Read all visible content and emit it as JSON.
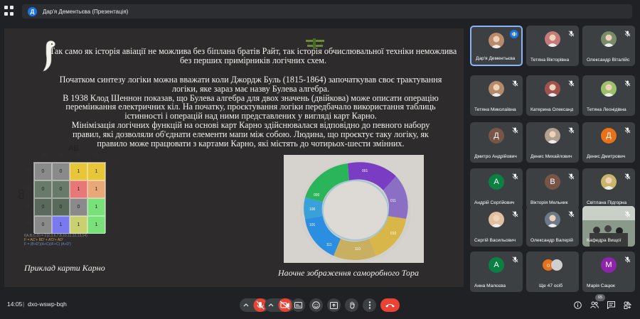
{
  "header": {
    "presenter_initial": "Д",
    "presentation_title": "Дар'я Дементьєва (Презентація)"
  },
  "slide": {
    "paragraph1": "Так само як історія авіації не можлива без біплана братів Райт, так  історія обчислювальної техніки неможлива без перших примірників логічних схем.",
    "paragraph2": "Початком синтезу логіки можна вважати коли Джордж Буль (1815-1864) започаткував своє трактування логіки, яке зараз має назву Булева алгебра.",
    "paragraph3": "В 1938 Клод Шеннон показав, що Булева алгебра для двох значень (двійкова) може описати операцію переміикання електричних кіл. На початку, проєктування логіки передбачало використання таблиць істинності і операцій над ними представлених у вигляді карт Карно.",
    "paragraph4": "Мінімізація логічних функцій на основі карт Карно здійснювалася відповідно до певного набору правил, які дозволяли об'єднати елементи мапи між собою. Людина, що проєктує таку логіку, як правило може працювати з картами Карно, які містять  до чотирьох-шести змінних.",
    "kmap": {
      "ab_label": "AB",
      "cd_label": "CD",
      "col_heads": [
        "00",
        "01",
        "11",
        "10"
      ],
      "row_heads": [
        "00",
        "01",
        "11",
        "10"
      ],
      "cells": [
        "0",
        "0",
        "1",
        "1",
        "0",
        "0",
        "1",
        "1",
        "0",
        "0",
        "0",
        "1",
        "0",
        "1",
        "1",
        "1"
      ],
      "formula1": "f(A,B,C,D) = Σ(2,3,6,7,8,10,11,12,13,14)",
      "formula2": "F = AC'+ BD' + A'D'+ AD'",
      "formula3": "F = (B+D')(A+C)(A'+C)  (A+D')"
    },
    "caption_left": "Приклад карти Карно",
    "caption_right": "Наочне зображення саморобного Тора",
    "torus_labels": [
      "000",
      "001",
      "011",
      "010",
      "110",
      "111",
      "101",
      "100"
    ]
  },
  "participants": [
    {
      "name": "Дар'я Дементьєва",
      "type": "photo",
      "color": "#b98a6b",
      "speaking": true
    },
    {
      "name": "Тетяна Вікторівна",
      "type": "photo",
      "color": "#c47a7a"
    },
    {
      "name": "Олександр Віталійович",
      "type": "photo",
      "color": "#7a8b6a"
    },
    {
      "name": "Тетяна Миколаївна",
      "type": "photo",
      "color": "#b58a6a"
    },
    {
      "name": "Катерина Олександрівна",
      "type": "photo",
      "color": "#a0524f"
    },
    {
      "name": "Тетяна Леонідівна",
      "type": "photo",
      "color": "#9bbf6a"
    },
    {
      "name": "Дмитро Андрійович",
      "type": "initial",
      "initial": "Д",
      "color": "#795548"
    },
    {
      "name": "Денис Михайлович",
      "type": "photo",
      "color": "#b0a090"
    },
    {
      "name": "Денис Дмитрович",
      "type": "initial",
      "initial": "Д",
      "color": "#e8711a"
    },
    {
      "name": "Андрій Сергійович",
      "type": "initial",
      "initial": "А",
      "color": "#0b8043"
    },
    {
      "name": "Вікторія Мельник",
      "type": "initial",
      "initial": "В",
      "color": "#795548"
    },
    {
      "name": "Світлана Підгорна",
      "type": "photo",
      "color": "#c9b56a"
    },
    {
      "name": "Сергій Васильович",
      "type": "photo",
      "color": "#e0c0a0"
    },
    {
      "name": "Олександр Валерійович",
      "type": "photo",
      "color": "#6a7a8a"
    },
    {
      "name": "Кафедра Вищої",
      "type": "room",
      "color": "#5a6a5a"
    },
    {
      "name": "Анна Малєєва",
      "type": "initial",
      "initial": "А",
      "color": "#0b8043"
    },
    {
      "name": "Ще 47 осіб",
      "type": "more",
      "color": "#e8711a"
    },
    {
      "name": "Марія Сацюк",
      "type": "initial",
      "initial": "М",
      "color": "#8e24aa"
    }
  ],
  "bottom": {
    "time": "14:05",
    "separator": "|",
    "meeting_code": "dxo-wswp-bqh",
    "participants_badge": "65"
  }
}
